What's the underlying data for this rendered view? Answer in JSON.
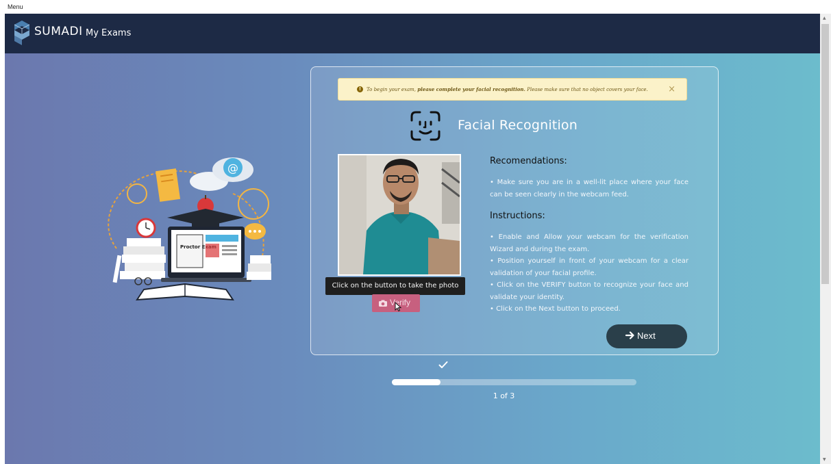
{
  "window": {
    "menu_label": "Menu"
  },
  "navbar": {
    "brand": "SUMADI",
    "link": "My Exams"
  },
  "alert": {
    "icon": "info-icon",
    "prefix": "To begin your exam, ",
    "bold": "please complete your facial recognition.",
    "suffix": " Please make sure that no object covers your face.",
    "close": "×"
  },
  "wizard": {
    "title": "Facial Recognition",
    "tooltip": "Click on the button to take the photo",
    "verify_label": "Verify",
    "recommendations_heading": "Recomendations:",
    "recommendations_text": "• Make sure you are in a well-lit place where your face can be seen clearly in the webcam feed.",
    "instructions_heading": "Instructions:",
    "instructions_text": "• Enable and Allow your webcam for the verification Wizard and during the exam.\n• Position yourself in front of your webcam for a clear validation of your facial profile.\n• Click on the VERIFY button to recognize your face and validate your identity.\n• Click on the Next button to proceed.",
    "next_label": "Next"
  },
  "illustration": {
    "tag": "Proctor Exam"
  },
  "progress": {
    "step": 1,
    "total": 3,
    "fraction": 0.2,
    "label": "1 of 3"
  },
  "colors": {
    "navbar": "#1d2a45",
    "verify": "#c7607f",
    "next": "#2a3f4a",
    "alert_bg": "#fbf2c9"
  },
  "icons": [
    "sumadi-logo-icon",
    "face-scan-icon",
    "camera-icon",
    "arrow-right-icon",
    "check-icon",
    "close-icon"
  ]
}
